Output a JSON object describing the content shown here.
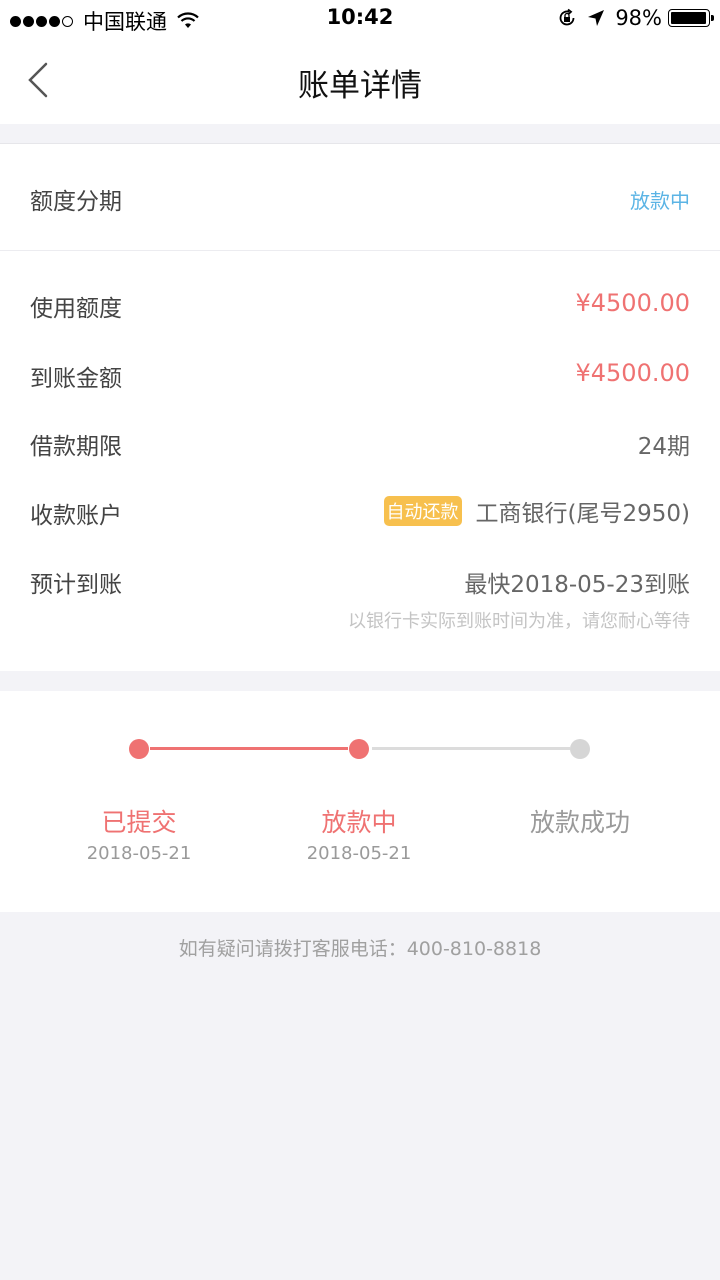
{
  "status_bar": {
    "carrier": "中国联通",
    "time": "10:42",
    "battery_percent": "98%",
    "battery_level": 0.98,
    "signal_bars": 4,
    "icons": [
      "signal-dots-icon",
      "wifi-icon",
      "orientation-lock-icon",
      "location-arrow-icon",
      "battery-icon"
    ]
  },
  "navbar": {
    "title": "账单详情",
    "back_icon": "chevron-left-icon"
  },
  "summary": {
    "label": "额度分期",
    "status": "放款中",
    "status_color": "#5bb4e5"
  },
  "details": {
    "used_amount": {
      "label": "使用额度",
      "value": "¥4500.00"
    },
    "received_amount": {
      "label": "到账金额",
      "value": "¥4500.00"
    },
    "term": {
      "label": "借款期限",
      "value": "24期"
    },
    "account": {
      "label": "收款账户",
      "badge": "自动还款",
      "value": "工商银行(尾号2950)"
    },
    "eta": {
      "label": "预计到账",
      "value": "最快2018-05-23到账",
      "note": "以银行卡实际到账时间为准，请您耐心等待"
    }
  },
  "progress": {
    "steps": [
      {
        "label": "已提交",
        "date": "2018-05-21",
        "state": "done"
      },
      {
        "label": "放款中",
        "date": "2018-05-21",
        "state": "current"
      },
      {
        "label": "放款成功",
        "date": "",
        "state": "pending"
      }
    ],
    "active_color": "#ef7272",
    "inactive_color": "#d6d6d6"
  },
  "footer": {
    "text": "如有疑问请拨打客服电话：400-810-8818"
  }
}
